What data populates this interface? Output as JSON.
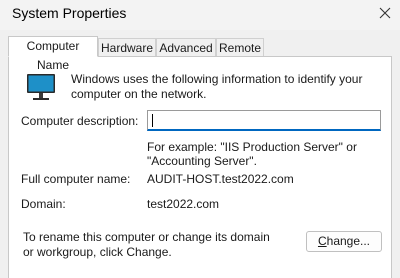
{
  "window": {
    "title": "System Properties"
  },
  "tabs": [
    {
      "label": "Computer Name",
      "active": true
    },
    {
      "label": "Hardware",
      "active": false
    },
    {
      "label": "Advanced",
      "active": false
    },
    {
      "label": "Remote",
      "active": false
    }
  ],
  "panel": {
    "intro": "Windows uses the following information to identify your computer on the network.",
    "description_label": "Computer description:",
    "description_value": "",
    "example": "For example: \"IIS Production Server\" or \"Accounting Server\".",
    "full_name_label": "Full computer name:",
    "full_name_value": "AUDIT-HOST.test2022.com",
    "domain_label": "Domain:",
    "domain_value": "test2022.com",
    "rename_text": "To rename this computer or change its domain or workgroup, click Change.",
    "change_button": {
      "mnemonic": "C",
      "rest": "hange..."
    }
  },
  "icons": {
    "close": "close-icon",
    "computer": "computer-monitor-icon"
  },
  "colors": {
    "monitor_screen": "#1e90c8",
    "input_focus_border": "#0067c0"
  }
}
